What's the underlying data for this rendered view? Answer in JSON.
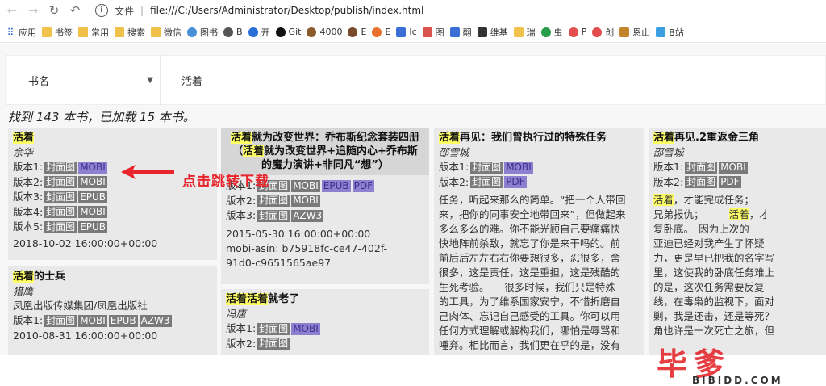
{
  "browser": {
    "url_scheme_label": "文件",
    "url": "file:///C:/Users/Administrator/Desktop/publish/index.html",
    "bookmarks": [
      {
        "label": "应用",
        "icon": "apps-icon"
      },
      {
        "label": "书签",
        "icon": "folder-icon"
      },
      {
        "label": "常用",
        "icon": "folder-icon"
      },
      {
        "label": "搜索",
        "icon": "folder-icon"
      },
      {
        "label": "微信",
        "icon": "folder-icon"
      },
      {
        "label": "图书",
        "icon": "globe-icon"
      },
      {
        "label": "B",
        "icon": "circle-icon"
      },
      {
        "label": "开",
        "icon": "circle-icon"
      },
      {
        "label": "Git",
        "icon": "github-icon"
      },
      {
        "label": "4000",
        "icon": "circle-icon"
      },
      {
        "label": "E",
        "icon": "circle-icon"
      },
      {
        "label": "E",
        "icon": "circle-icon"
      },
      {
        "label": "Ic",
        "icon": "square-icon"
      },
      {
        "label": "图",
        "icon": "square-icon"
      },
      {
        "label": "翻",
        "icon": "square-icon"
      },
      {
        "label": "维基",
        "icon": "wiki-icon"
      },
      {
        "label": "瑞",
        "icon": "square-icon"
      },
      {
        "label": "虫",
        "icon": "circle-icon"
      },
      {
        "label": "P",
        "icon": "circle-icon"
      },
      {
        "label": "创",
        "icon": "circle-icon"
      },
      {
        "label": "恩山",
        "icon": "square-icon"
      },
      {
        "label": "B站",
        "icon": "square-icon"
      }
    ]
  },
  "search": {
    "field_label": "书名",
    "query": "活着"
  },
  "summary": "找到 143 本书，已加载 15 本书。",
  "annotation": "点击跳转下载",
  "labels": {
    "cover": "封面图",
    "version1": "版本1:",
    "version2": "版本2:",
    "version3": "版本3:",
    "version4": "版本4:",
    "version5": "版本5:",
    "mobi": "MOBI",
    "epub": "EPUB",
    "pdf": "PDF",
    "azw3": "AZW3"
  },
  "books": {
    "b1": {
      "title": "活着",
      "author": "余华",
      "date": "2018-10-02 16:00:00+00:00"
    },
    "b2": {
      "title_hl": "活着",
      "title_rest": "的士兵",
      "author": "猎鹰",
      "publisher": "凤凰出版传媒集团/凤凰出版社",
      "date": "2010-08-31 16:00:00+00:00"
    },
    "b3": {
      "title_hl": "活着",
      "title_rest": "就为改变世界：乔布斯纪念套装四册",
      "title_line2a": "（",
      "title_line2hl": "活着",
      "title_line2b": "就为改变世界+追随内心+乔布斯",
      "title_line3": "的魔力演讲+非同凡“想”）",
      "date": "2015-05-30 16:00:00+00:00",
      "asin_line1": "mobi-asin: b75918fc-ce47-402f-",
      "asin_line2": "91d0-c9651565ae97"
    },
    "b4": {
      "title_hl1": "活着",
      "title_hl2": "活着",
      "title_rest": "就老了",
      "author": "冯唐"
    },
    "b5": {
      "title_hl": "活着",
      "title_rest": "再见：我们曾执行过的特殊任务",
      "author": "邵雪城",
      "desc": [
        "任务，听起来那么的简单。“把一个人带回",
        "来，把你的同事安全地带回来”，但做起来",
        "多么多么的难。你不能光顾自己要痛痛快",
        "快地阵前杀敌，就忘了你是来干吗的。前",
        "前后后左左右右你要想很多，忍很多，舍",
        "很多，这是责任，这是重担，这是残酷的",
        "生死考验。　　很多时候，我们只是特殊",
        "的工具，为了维系国家安宁，不惜折磨自",
        "己肉体、忘记自己感受的工具。你可以用",
        "任何方式理解或解构我们，哪怕是辱骂和",
        "唾弃。相比而言，我们更在乎的是，没有",
        "人能在这片国土上肆便剥夺你的生命"
      ]
    },
    "b6": {
      "title_hl": "活着",
      "title_rest": "再见.2重返金三角",
      "author": "邵雪城",
      "desc_lines": [
        "，才能完成任务；",
        "兄弟报仇；",
        "，才",
        "复卧底。　因为上次的",
        "亚迪已经对我产生了怀疑",
        "力，更是早已把我的名字写",
        "里，这使我的卧底任务难上",
        "的是，这次任务需要反复",
        "线，在毒枭的监视下，面对",
        "剿，我是还击，还是等死？",
        "角也许是一次死亡之旅，但"
      ]
    }
  },
  "watermark": {
    "text": "毕爹",
    "domain": "BIBIDD.COM"
  },
  "colors": {
    "highlight": "#ffff66",
    "mobi_tag": "#8e7fcf",
    "tag": "#7a7a7a",
    "annotation": "#e8242c"
  }
}
